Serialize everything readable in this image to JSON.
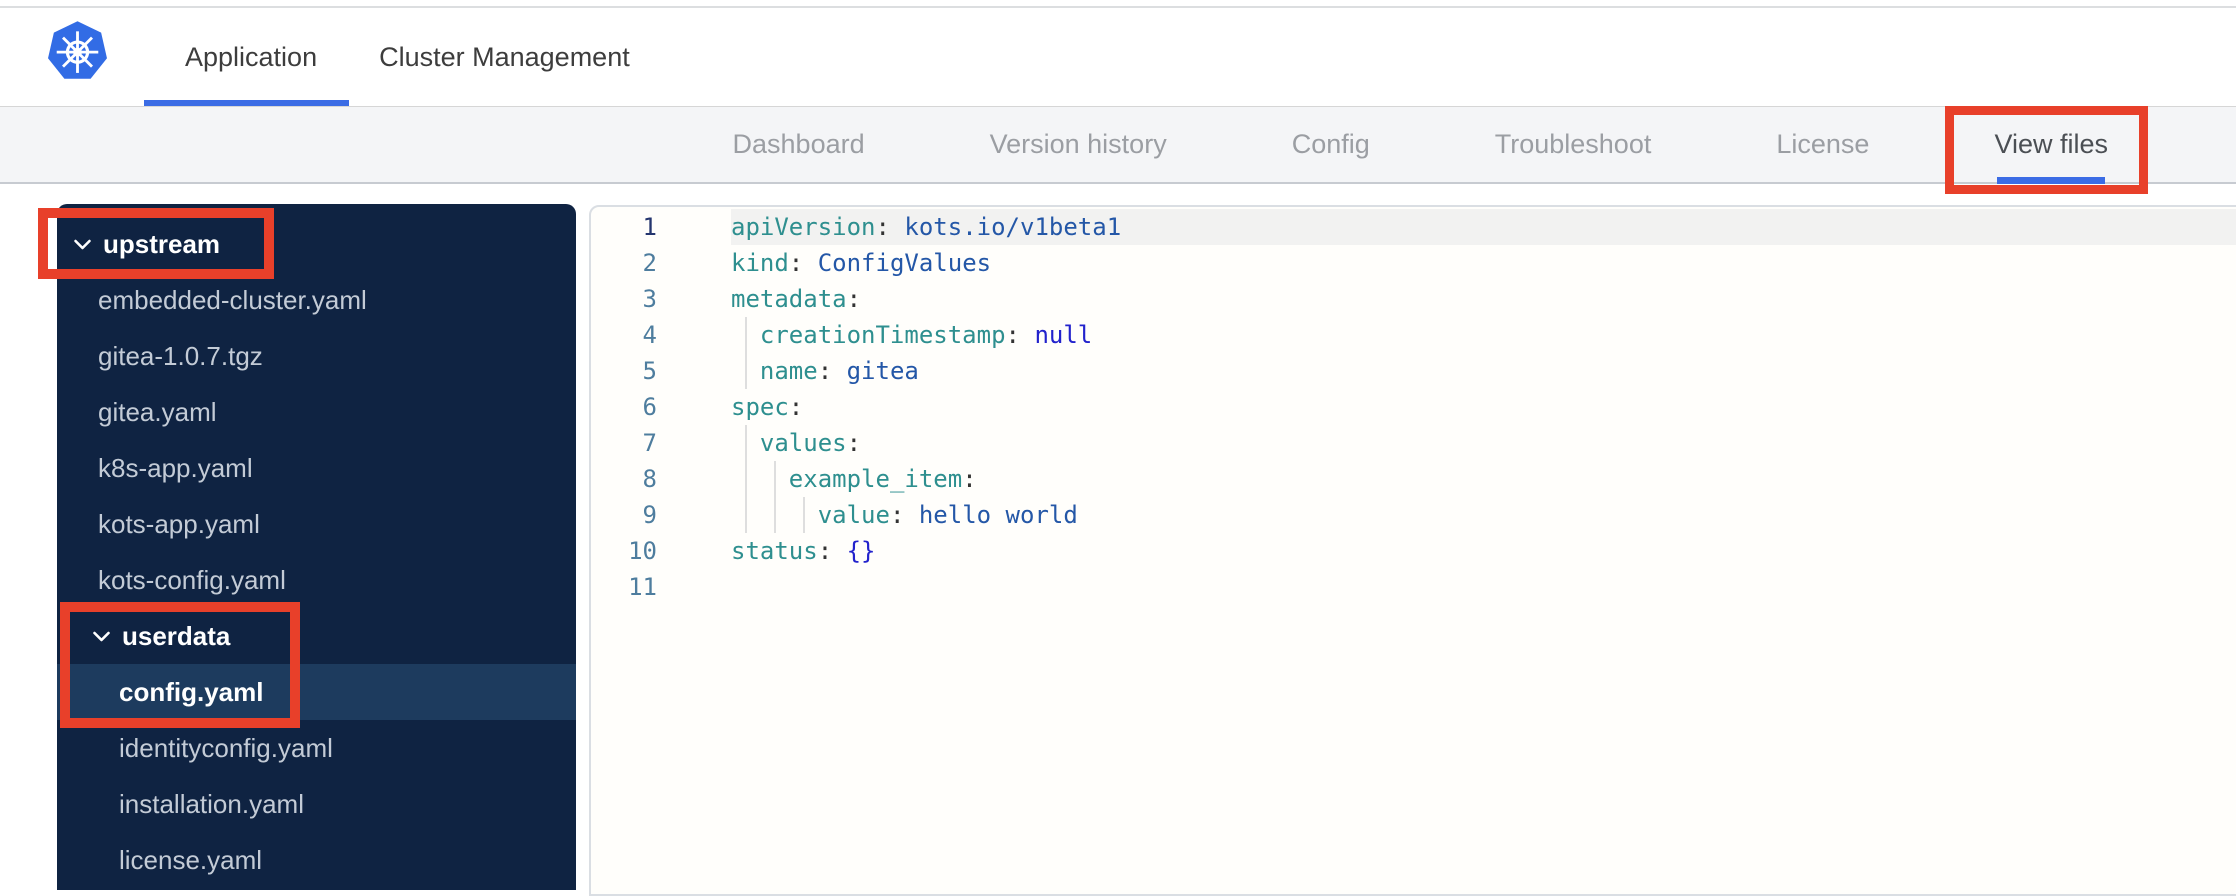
{
  "colors": {
    "accent_blue": "#3b6ce5",
    "kubernetes_blue": "#326ce5",
    "annotation_red": "#e8402a",
    "sidebar_bg": "#0f2342",
    "sidebar_selected_bg": "#1d3b5e",
    "syntax_key_teal": "#2e8f8f",
    "syntax_value_blue": "#2457a7",
    "syntax_atom_blue": "#2222cc"
  },
  "topnav": {
    "items": [
      {
        "label": "Application",
        "active": true
      },
      {
        "label": "Cluster Management",
        "active": false
      }
    ]
  },
  "subnav": {
    "items": [
      {
        "label": "Dashboard",
        "active": false
      },
      {
        "label": "Version history",
        "active": false
      },
      {
        "label": "Config",
        "active": false
      },
      {
        "label": "Troubleshoot",
        "active": false
      },
      {
        "label": "License",
        "active": false
      },
      {
        "label": "View files",
        "active": true
      }
    ]
  },
  "file_tree": {
    "items": [
      {
        "label": "upstream",
        "type": "folder",
        "level": 0,
        "expanded": true,
        "selected": false
      },
      {
        "label": "embedded-cluster.yaml",
        "type": "file",
        "level": 1,
        "selected": false
      },
      {
        "label": "gitea-1.0.7.tgz",
        "type": "file",
        "level": 1,
        "selected": false
      },
      {
        "label": "gitea.yaml",
        "type": "file",
        "level": 1,
        "selected": false
      },
      {
        "label": "k8s-app.yaml",
        "type": "file",
        "level": 1,
        "selected": false
      },
      {
        "label": "kots-app.yaml",
        "type": "file",
        "level": 1,
        "selected": false
      },
      {
        "label": "kots-config.yaml",
        "type": "file",
        "level": 1,
        "selected": false
      },
      {
        "label": "userdata",
        "type": "folder",
        "level": 1,
        "expanded": true,
        "selected": false
      },
      {
        "label": "config.yaml",
        "type": "file",
        "level": 2,
        "selected": true
      },
      {
        "label": "identityconfig.yaml",
        "type": "file",
        "level": 2,
        "selected": false
      },
      {
        "label": "installation.yaml",
        "type": "file",
        "level": 2,
        "selected": false
      },
      {
        "label": "license.yaml",
        "type": "file",
        "level": 2,
        "selected": false
      }
    ]
  },
  "editor": {
    "language": "yaml",
    "lines": [
      {
        "num": "1",
        "indent": 0,
        "active": true,
        "tokens": [
          [
            "key",
            "apiVersion"
          ],
          [
            "p",
            ": "
          ],
          [
            "v",
            "kots.io/v1beta1"
          ]
        ]
      },
      {
        "num": "2",
        "indent": 0,
        "active": false,
        "tokens": [
          [
            "key",
            "kind"
          ],
          [
            "p",
            ": "
          ],
          [
            "v",
            "ConfigValues"
          ]
        ]
      },
      {
        "num": "3",
        "indent": 0,
        "active": false,
        "tokens": [
          [
            "key",
            "metadata"
          ],
          [
            "p",
            ":"
          ]
        ]
      },
      {
        "num": "4",
        "indent": 1,
        "active": false,
        "tokens": [
          [
            "key",
            "creationTimestamp"
          ],
          [
            "p",
            ": "
          ],
          [
            "a",
            "null"
          ]
        ]
      },
      {
        "num": "5",
        "indent": 1,
        "active": false,
        "tokens": [
          [
            "key",
            "name"
          ],
          [
            "p",
            ": "
          ],
          [
            "v",
            "gitea"
          ]
        ]
      },
      {
        "num": "6",
        "indent": 0,
        "active": false,
        "tokens": [
          [
            "key",
            "spec"
          ],
          [
            "p",
            ":"
          ]
        ]
      },
      {
        "num": "7",
        "indent": 1,
        "active": false,
        "tokens": [
          [
            "key",
            "values"
          ],
          [
            "p",
            ":"
          ]
        ]
      },
      {
        "num": "8",
        "indent": 2,
        "active": false,
        "tokens": [
          [
            "key",
            "example_item"
          ],
          [
            "p",
            ":"
          ]
        ]
      },
      {
        "num": "9",
        "indent": 3,
        "active": false,
        "tokens": [
          [
            "key",
            "value"
          ],
          [
            "p",
            ": "
          ],
          [
            "v",
            "hello world"
          ]
        ]
      },
      {
        "num": "10",
        "indent": 0,
        "active": false,
        "tokens": [
          [
            "key",
            "status"
          ],
          [
            "p",
            ": "
          ],
          [
            "a",
            "{}"
          ]
        ]
      },
      {
        "num": "11",
        "indent": 0,
        "active": false,
        "tokens": []
      }
    ]
  },
  "annotations": {
    "boxes": [
      {
        "target": "upstream folder row"
      },
      {
        "target": "userdata folder and config.yaml file rows"
      },
      {
        "target": "View files tab"
      }
    ]
  }
}
